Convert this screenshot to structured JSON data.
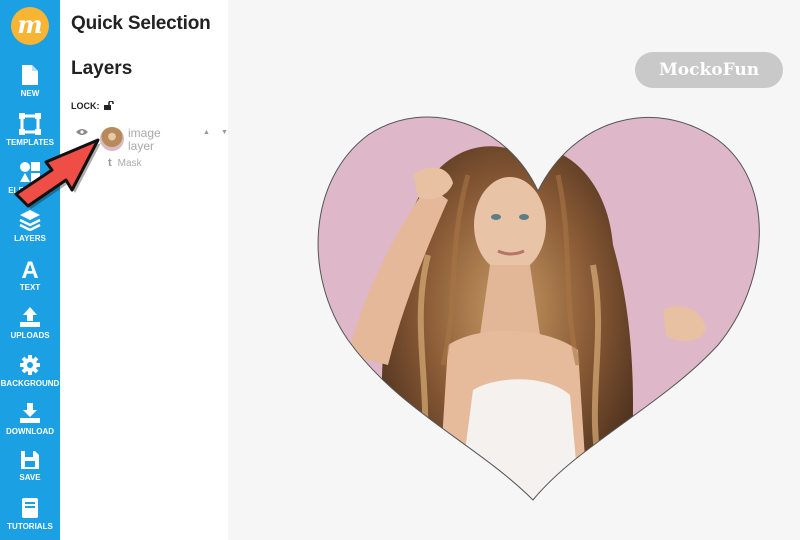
{
  "logo": {
    "letter": "m",
    "color": "#f7b533"
  },
  "rail": {
    "color": "#1ba0e3",
    "items": [
      {
        "label": "NEW",
        "icon": "new-document-icon"
      },
      {
        "label": "TEMPLATES",
        "icon": "templates-icon"
      },
      {
        "label": "ELEMENTS",
        "icon": "elements-icon"
      },
      {
        "label": "LAYERS",
        "icon": "layers-icon"
      },
      {
        "label": "TEXT",
        "icon": "text-icon"
      },
      {
        "label": "UPLOADS",
        "icon": "upload-icon"
      },
      {
        "label": "BACKGROUND",
        "icon": "gear-icon"
      },
      {
        "label": "DOWNLOAD",
        "icon": "download-icon"
      },
      {
        "label": "SAVE",
        "icon": "save-icon"
      },
      {
        "label": "TUTORIALS",
        "icon": "book-icon"
      }
    ]
  },
  "panel": {
    "title": "Quick Selection",
    "heading": "Layers",
    "lock_label": "LOCK:",
    "layer": {
      "name": "image layer",
      "mask_label": "Mask",
      "mask_icon_text": "t"
    }
  },
  "canvas": {
    "watermark": "MockoFun",
    "image_description_shape": "heart"
  }
}
